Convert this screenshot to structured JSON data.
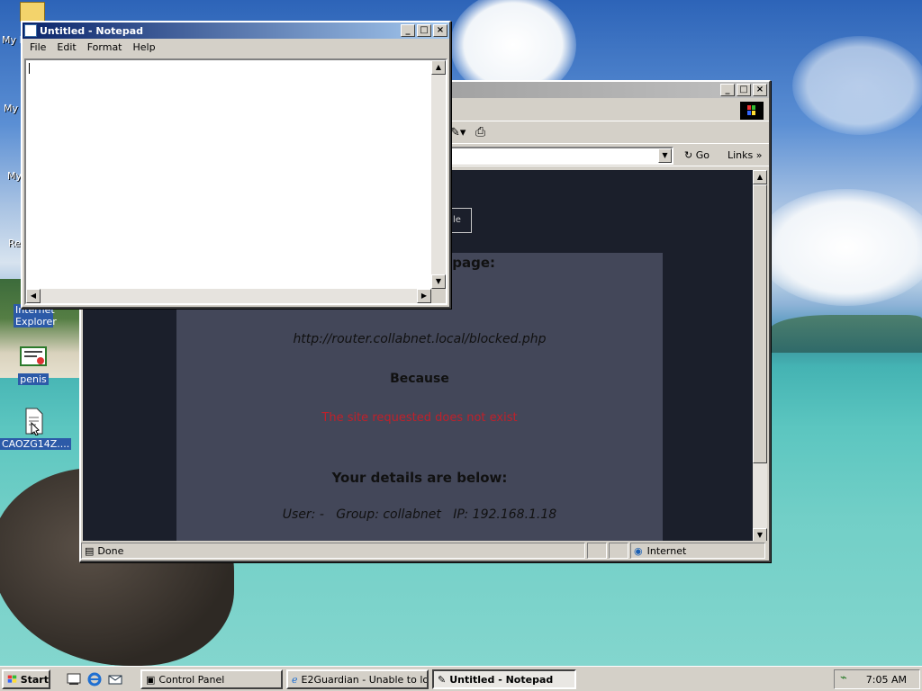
{
  "desktop": {
    "icons": [
      {
        "label": "My D",
        "icon": "my-documents-icon"
      },
      {
        "label": "My",
        "icon": "my-computer-icon"
      },
      {
        "label": "My",
        "icon": "my-network-places-icon"
      },
      {
        "label": "Re",
        "icon": "recycle-bin-icon"
      },
      {
        "label": "Internet Explorer",
        "icon": "internet-explorer-icon"
      },
      {
        "label": "penis",
        "icon": "certificate-icon"
      },
      {
        "label": "CAOZG14Z....",
        "icon": "document-icon"
      }
    ]
  },
  "notepad": {
    "title": "Untitled - Notepad",
    "menu": [
      "File",
      "Edit",
      "Format",
      "Help"
    ],
    "text": ""
  },
  "ie": {
    "toolbar": {
      "go_label": "Go",
      "links_label": "Links"
    },
    "page": {
      "button_fragment": "le",
      "heading": "sue loading this page:",
      "url": "http://router.collabnet.local/blocked.php",
      "because": "Because",
      "reason": "The site requested does not exist",
      "details_heading": "Your details are below:",
      "details": "User: -   Group: collabnet   IP: 192.168.1.18"
    },
    "status": {
      "text": "Done",
      "zone": "Internet"
    }
  },
  "taskbar": {
    "start": "Start",
    "tasks": [
      {
        "label": "Control Panel",
        "active": false
      },
      {
        "label": "E2Guardian - Unable to lo...",
        "active": false
      },
      {
        "label": "Untitled - Notepad",
        "active": true
      }
    ],
    "clock": "7:05 AM"
  },
  "colors": {
    "title_active": "#0a246a",
    "reason_text": "#c0202a",
    "page_bg": "#1b1f2b",
    "panel_bg": "#434759"
  }
}
